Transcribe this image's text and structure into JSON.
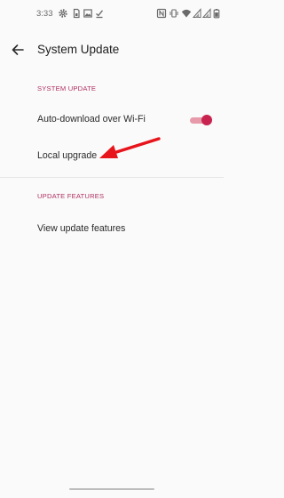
{
  "status_bar": {
    "time": "3:33",
    "left_icons": [
      "gear-icon",
      "sim-card-icon",
      "image-icon",
      "download-done-icon"
    ],
    "right_icons": [
      "nfc-icon",
      "vibrate-icon",
      "wifi-icon",
      "signal-icon",
      "signal-icon",
      "battery-icon"
    ]
  },
  "toolbar": {
    "back_icon": "arrow-left-icon",
    "title": "System Update"
  },
  "sections": [
    {
      "header": "SYSTEM UPDATE",
      "items": [
        {
          "label": "Auto-download over Wi-Fi",
          "toggle_on": true
        },
        {
          "label": "Local upgrade"
        }
      ]
    },
    {
      "header": "UPDATE FEATURES",
      "items": [
        {
          "label": "View update features"
        }
      ]
    }
  ],
  "annotation": {
    "icon": "red-arrow-icon",
    "color": "#e8141b"
  },
  "colors": {
    "accent": "#c8234f",
    "section_header": "#b03060",
    "background": "#fafafa"
  }
}
